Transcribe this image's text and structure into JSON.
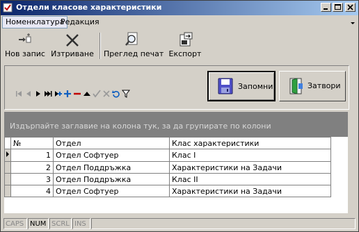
{
  "window": {
    "title": "Отдели класове характеристики"
  },
  "menu": {
    "items": [
      "Номенклатура",
      "Редакция"
    ]
  },
  "toolbar": {
    "new_label": "Нов запис",
    "delete_label": "Изтриване",
    "preview_label": "Преглед печат",
    "export_label": "Експорт"
  },
  "actions": {
    "save_label": "Запомни",
    "close_label": "Затвори"
  },
  "group_panel": {
    "hint": "Издърпайте заглавие на колона тук, за да групирате по колони"
  },
  "grid": {
    "columns": [
      "№",
      "Отдел",
      "Клас характеристики"
    ],
    "rows": [
      {
        "num": "1",
        "dept": "Отдел Софтуер",
        "cls": "Клас I"
      },
      {
        "num": "2",
        "dept": "Отдел Поддръжка",
        "cls": "Характеристики на Задачи"
      },
      {
        "num": "3",
        "dept": "Отдел Поддръжка",
        "cls": "Клас II"
      },
      {
        "num": "4",
        "dept": "Отдел Софтуер",
        "cls": "Характеристики на Задачи"
      }
    ]
  },
  "statusbar": {
    "caps": "CAPS",
    "num": "NUM",
    "scrl": "SCRL",
    "ins": "INS"
  }
}
